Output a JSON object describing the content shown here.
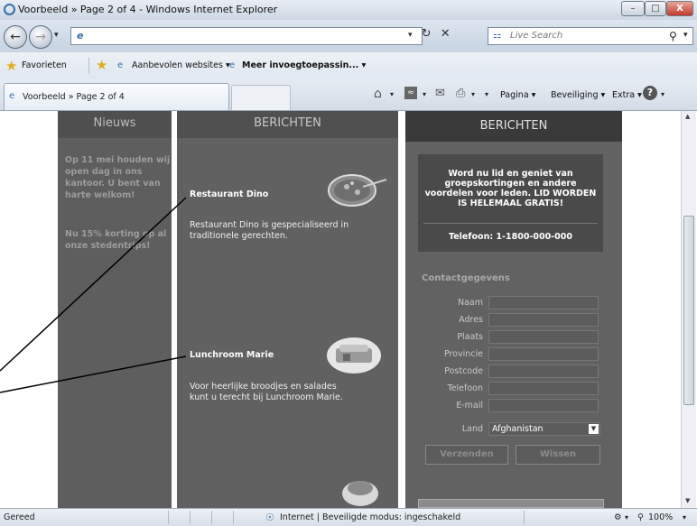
{
  "window": {
    "title": "Voorbeeld » Page 2 of 4 - Windows Internet Explorer",
    "min": "–",
    "max": "□",
    "close": "X"
  },
  "addressbar": {
    "url": "e",
    "search_placeholder": "Live Search"
  },
  "favorites_bar": {
    "favorites": "Favorieten",
    "recommended": "Aanbevolen websites ▾",
    "addons": "Meer invoegtoepassin... ▾"
  },
  "tab": {
    "label": "Voorbeeld » Page 2 of 4"
  },
  "command_bar": {
    "page": "Pagina ▾",
    "security": "Beveiliging ▾",
    "extra": "Extra ▾"
  },
  "nieuws": {
    "heading": "Nieuws",
    "paragraph1": "Op 11 mei houden wij open dag in ons kantoor. U bent van harte welkom!",
    "paragraph2": "Nu 15% korting op al onze stedentrips!"
  },
  "berichten": {
    "heading": "BERICHTEN",
    "items": [
      {
        "title": "Restaurant Dino",
        "description": "Restaurant Dino is gespecialiseerd in traditionele gerechten."
      },
      {
        "title": "Lunchroom Marie",
        "description": "Voor heerlijke broodjes en salades kunt u terecht bij Lunchroom Marie."
      }
    ]
  },
  "right_panel": {
    "heading": "BERICHTEN",
    "promo": "Word nu lid en geniet van groepskortingen en andere voordelen voor leden. LID WORDEN IS HELEMAAL GRATIS!",
    "phone": "Telefoon:  1-1800-000-000",
    "contact_heading": "Contactgegevens",
    "fields": [
      "Naam",
      "Adres",
      "Plaats",
      "Provincie",
      "Postcode",
      "Telefoon",
      "E-mail"
    ],
    "country_label": "Land",
    "country_value": "Afghanistan",
    "submit": "Verzenden",
    "clear": "Wissen"
  },
  "statusbar": {
    "status": "Gereed",
    "zone": "Internet | Beveiligde modus: ingeschakeld",
    "zoom": "100%"
  }
}
